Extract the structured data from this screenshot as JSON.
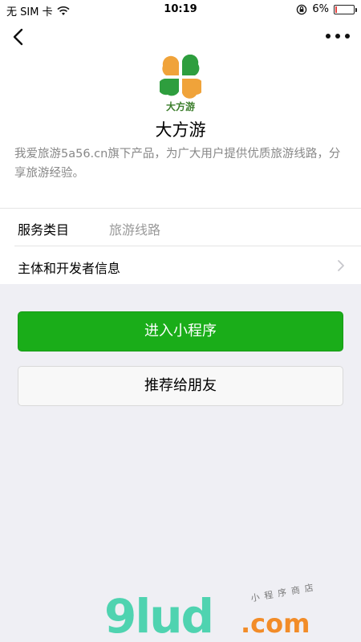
{
  "status_bar": {
    "carrier": "无 SIM 卡",
    "time": "10:19",
    "battery_percent": "6%",
    "battery_level": 0.06,
    "battery_color": "#e64340",
    "icons": [
      "wifi-icon",
      "rotation-lock-icon",
      "battery-icon"
    ]
  },
  "nav": {
    "back_icon": "chevron-left-icon",
    "more_icon": "more-dots-icon"
  },
  "app": {
    "logo_text": "大方游",
    "name": "大方游",
    "description": "我爱旅游5a56.cn旗下产品，为广大用户提供优质旅游线路，分享旅游经验。"
  },
  "service_row": {
    "label": "服务类目",
    "value": "旅游线路"
  },
  "info_row": {
    "label": "主体和开发者信息",
    "chevron_icon": "chevron-right-icon"
  },
  "buttons": {
    "enter": "进入小程序",
    "enter_color": "#1aad19",
    "share": "推荐给朋友"
  },
  "watermark": {
    "brand": "9lud",
    "domain": ".com",
    "tagline": "小程序商店"
  }
}
